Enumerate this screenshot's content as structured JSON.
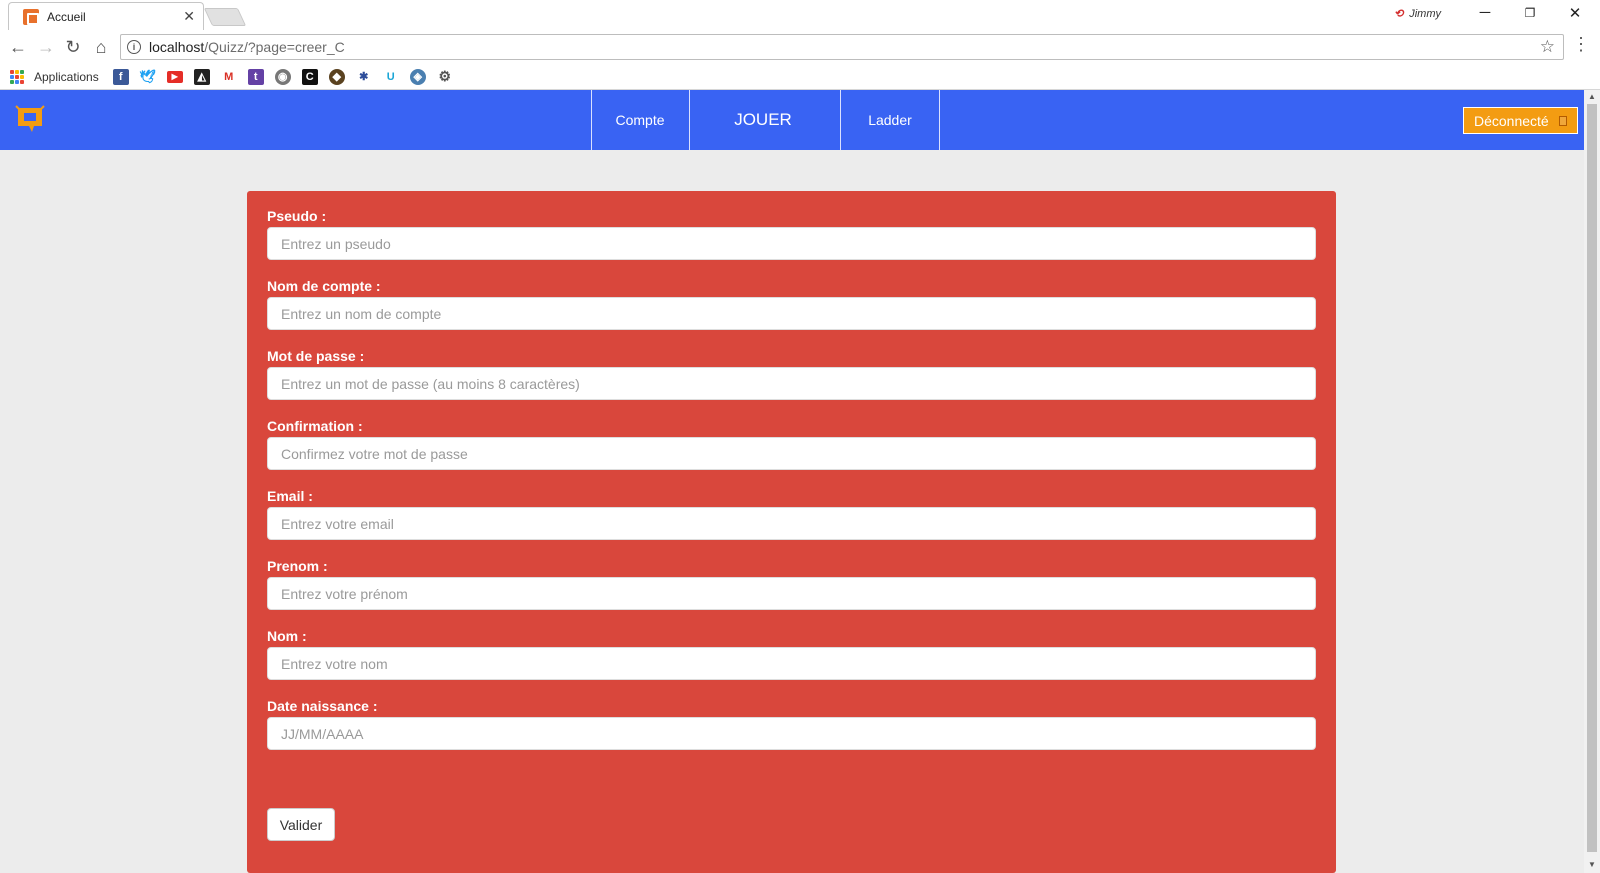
{
  "browser": {
    "tab_title": "Accueil",
    "tab_close": "✕",
    "profile_name": "Jimmy",
    "url_host": "localhost",
    "url_path": "/Quizz/?page=creer_C",
    "bookmarks_label": "Applications",
    "bookmark_icons": [
      "facebook-icon",
      "twitter-icon",
      "youtube-icon",
      "app-icon",
      "gmail-icon",
      "twitch-icon",
      "emblem-icon",
      "c-icon",
      "game-icon",
      "figure-icon",
      "u-icon",
      "drop-icon",
      "gear-icon"
    ]
  },
  "nav": {
    "account": "Compte",
    "play": "JOUER",
    "ladder": "Ladder",
    "logout": "Déconnecté"
  },
  "form": {
    "fields": [
      {
        "label": "Pseudo :",
        "placeholder": "Entrez un pseudo"
      },
      {
        "label": "Nom de compte :",
        "placeholder": "Entrez un nom de compte"
      },
      {
        "label": "Mot de passe :",
        "placeholder": "Entrez un mot de passe (au moins 8 caractères)"
      },
      {
        "label": "Confirmation :",
        "placeholder": "Confirmez votre mot de passe"
      },
      {
        "label": "Email :",
        "placeholder": "Entrez votre email"
      },
      {
        "label": "Prenom :",
        "placeholder": "Entrez votre prénom"
      },
      {
        "label": "Nom :",
        "placeholder": "Entrez votre nom"
      },
      {
        "label": "Date naissance :",
        "placeholder": "JJ/MM/AAAA"
      }
    ],
    "submit_label": "Valider"
  },
  "colors": {
    "navbar": "#3963f3",
    "panel": "#d9473c",
    "logout": "#f39c12"
  }
}
